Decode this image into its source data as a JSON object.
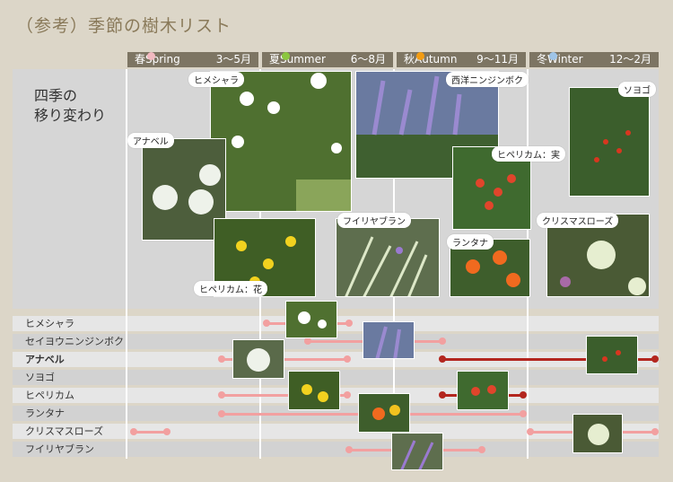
{
  "title": "（参考）季節の樹木リスト",
  "intro": "四季の\n移り変わり",
  "seasons": [
    {
      "kanji": "春",
      "name": "Spring",
      "months": "3〜5月",
      "color": "#f2b9c0"
    },
    {
      "kanji": "夏",
      "name": "Summer",
      "months": "6〜8月",
      "color": "#8cc63f"
    },
    {
      "kanji": "秋",
      "name": "Autumn",
      "months": "9〜11月",
      "color": "#f39c12"
    },
    {
      "kanji": "冬",
      "name": "Winter",
      "months": "12〜2月",
      "color": "#9fc5e8"
    }
  ],
  "photo_labels": {
    "himeshara": "ヒメシャラ",
    "seiyou": "西洋ニンジンボク",
    "soyogo": "ソヨゴ",
    "anabel": "アナベル",
    "hypericum_fruit": "ヒペリカム：実",
    "fuiriya": "フイリヤブラン",
    "christmas": "クリスマスローズ",
    "lantana": "ランタナ",
    "hypericum_flower": "ヒペリカム：花"
  },
  "rows": [
    {
      "name": "ヒメシャラ",
      "bold": false
    },
    {
      "name": "セイヨウニンジンボク",
      "bold": false
    },
    {
      "name": "アナベル",
      "bold": true
    },
    {
      "name": "ソヨゴ",
      "bold": false
    },
    {
      "name": "ヒペリカム",
      "bold": false
    },
    {
      "name": "ランタナ",
      "bold": false
    },
    {
      "name": "クリスマスローズ",
      "bold": false
    },
    {
      "name": "フイリヤブラン",
      "bold": false
    }
  ],
  "colors": {
    "flower_bar": "#f2a0a0",
    "fruit_bar": "#b3261e"
  }
}
